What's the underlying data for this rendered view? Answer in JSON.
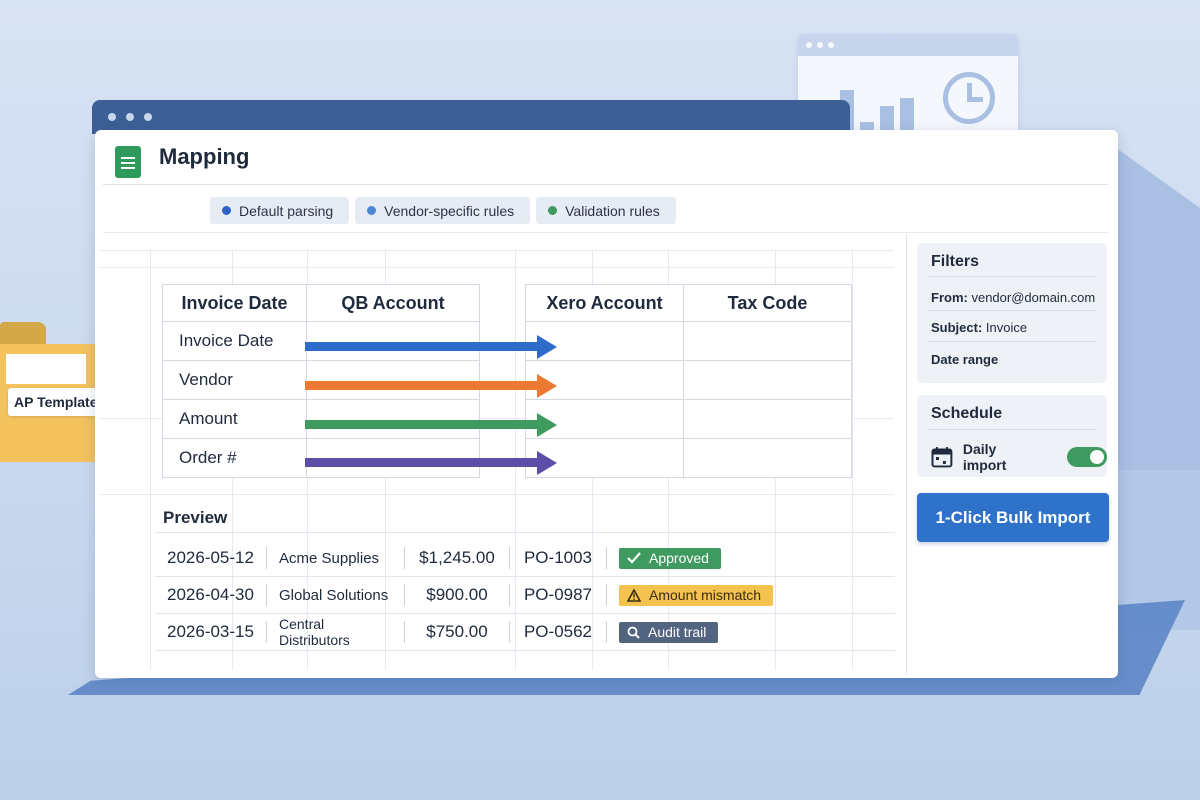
{
  "window": {
    "title": "Mapping"
  },
  "folder": {
    "label": "AP Template"
  },
  "chips": [
    {
      "label": "Default parsing",
      "color": "#2f62c4"
    },
    {
      "label": "Vendor-specific rules",
      "color": "#4d86d6"
    },
    {
      "label": "Validation rules",
      "color": "#3e9a5e"
    }
  ],
  "mapping": {
    "source_header": "Invoice Date",
    "qb_header": "QB Account",
    "xero_header": "Xero Account",
    "tax_header": "Tax Code",
    "rows": [
      {
        "field": "Invoice Date",
        "arrow_color": "#2f6bc9"
      },
      {
        "field": "Vendor",
        "arrow_color": "#ec7a33"
      },
      {
        "field": "Amount",
        "arrow_color": "#3e9a5e"
      },
      {
        "field": "Order #",
        "arrow_color": "#5b4ea8"
      }
    ]
  },
  "preview": {
    "title": "Preview",
    "rows": [
      {
        "date": "2026-05-12",
        "vendor": "Acme Supplies",
        "amount": "$1,245.00",
        "po": "PO-1003",
        "status": "Approved",
        "status_icon": "check-icon"
      },
      {
        "date": "2026-04-30",
        "vendor": "Global Solutions",
        "amount": "$900.00",
        "po": "PO-0987",
        "status": "Amount mismatch",
        "status_icon": "warning-icon"
      },
      {
        "date": "2026-03-15",
        "vendor": "Central Distributors",
        "amount": "$750.00",
        "po": "PO-0562",
        "status": "Audit trail",
        "status_icon": "search-icon"
      }
    ]
  },
  "filters": {
    "title": "Filters",
    "from_label": "From:",
    "from_value": "vendor@domain.com",
    "subject_label": "Subject:",
    "subject_value": "Invoice",
    "date_range": "Date range"
  },
  "schedule": {
    "title": "Schedule",
    "option": "Daily import",
    "enabled": true
  },
  "actions": {
    "bulk_import": "1-Click Bulk Import"
  }
}
